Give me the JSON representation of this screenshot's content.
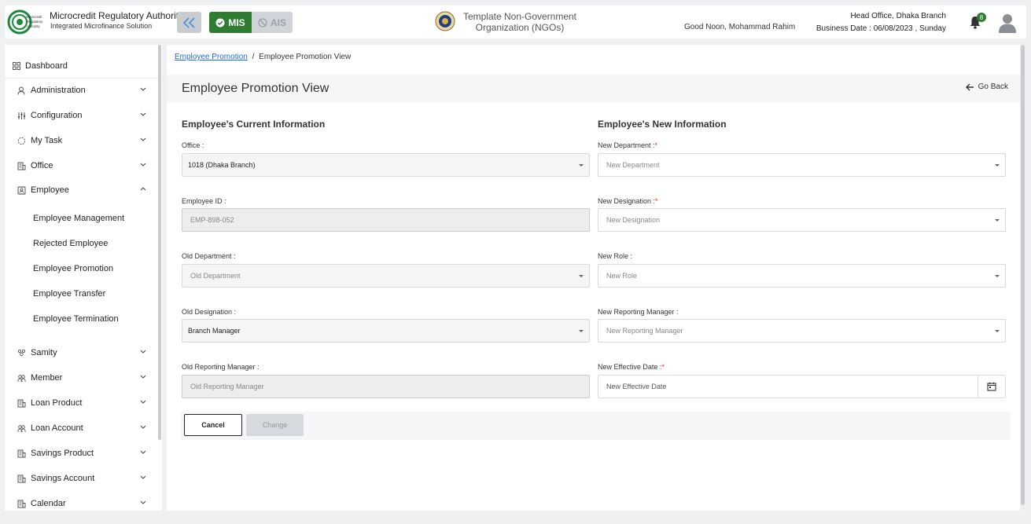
{
  "header": {
    "brand_title": "Microcredit Regulatory Authority",
    "brand_subtitle": "Integrated Microfinance Solution",
    "logo_text": [
      "Microcredit",
      "Regulatory",
      "Authority"
    ],
    "mis_label": "MIS",
    "ais_label": "AIS",
    "org_name_line1": "Template Non-Government",
    "org_name_line2": "Organization (NGOs)",
    "greeting": "Good Noon, Mohammad Rahim",
    "branch": "Head Office, Dhaka Branch",
    "business_date": "Business Date : 06/08/2023 , Sunday",
    "notification_count": "8"
  },
  "sidebar": {
    "dashboard": "Dashboard",
    "items": [
      {
        "label": "Administration"
      },
      {
        "label": "Configuration"
      },
      {
        "label": "My Task"
      },
      {
        "label": "Office"
      },
      {
        "label": "Employee"
      },
      {
        "label": "Samity"
      },
      {
        "label": "Member"
      },
      {
        "label": "Loan Product"
      },
      {
        "label": "Loan Account"
      },
      {
        "label": "Savings Product"
      },
      {
        "label": "Savings Account"
      },
      {
        "label": "Calendar"
      }
    ],
    "employee_sub": [
      {
        "label": "Employee Management"
      },
      {
        "label": "Rejected Employee"
      },
      {
        "label": "Employee Promotion"
      },
      {
        "label": "Employee Transfer"
      },
      {
        "label": "Employee Termination"
      }
    ]
  },
  "breadcrumb": {
    "parent": "Employee Promotion",
    "separator": "/",
    "current": "Employee Promotion View"
  },
  "page": {
    "title": "Employee Promotion View",
    "go_back": "Go Back"
  },
  "current_info": {
    "title": "Employee's Current Information",
    "office_label": "Office :",
    "office_value": "1018 (Dhaka Branch)",
    "employee_id_label": "Employee ID :",
    "employee_id_value": "EMP-898-052",
    "old_department_label": "Old Department :",
    "old_department_placeholder": "Old Department",
    "old_designation_label": "Old Designation :",
    "old_designation_value": "Branch Manager",
    "old_reporting_manager_label": "Old Reporting Manager :",
    "old_reporting_manager_placeholder": "Old Reporting Manager"
  },
  "new_info": {
    "title": "Employee's New Information",
    "new_department_label": "New Department :",
    "new_department_placeholder": "New Department",
    "new_designation_label": "New Designation :",
    "new_designation_placeholder": "New Designation",
    "new_role_label": "New Role :",
    "new_role_placeholder": "New Role",
    "new_reporting_manager_label": "New Reporting Manager :",
    "new_reporting_manager_placeholder": "New Reporting Manager",
    "new_effective_date_label": "New Effective Date :",
    "new_effective_date_placeholder": "New Effective Date",
    "required_mark": "*"
  },
  "actions": {
    "cancel": "Cancel",
    "change": "Change"
  },
  "colors": {
    "mis_green": "#2e7d32",
    "link_blue": "#1e6bd6",
    "required_red": "#d32f2f"
  }
}
